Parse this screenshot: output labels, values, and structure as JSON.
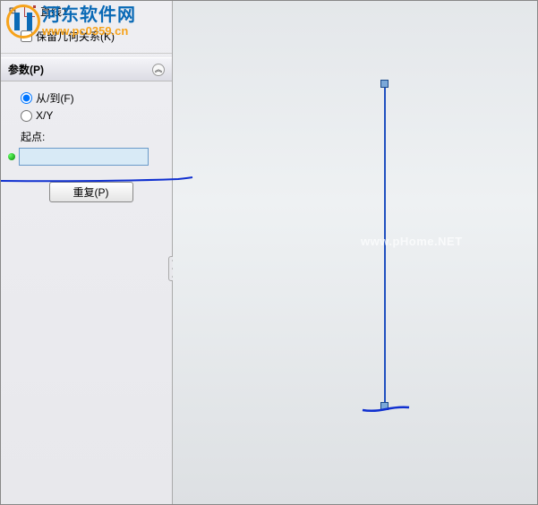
{
  "watermark": {
    "title_cn": "河东软件网",
    "url": "www.pc0359.cn",
    "center": "www.pHome.NET"
  },
  "tree": {
    "item_label": "直线1"
  },
  "options": {
    "keep_relations_label": "保留几何关系(K)"
  },
  "params": {
    "panel_title": "参数(P)",
    "radio_from_to": "从/到(F)",
    "radio_xy": "X/Y",
    "start_point_label": "起点:",
    "input_value": "",
    "repeat_button": "重复(P)"
  },
  "annotation_colors": {
    "stroke": "#1030d0"
  }
}
